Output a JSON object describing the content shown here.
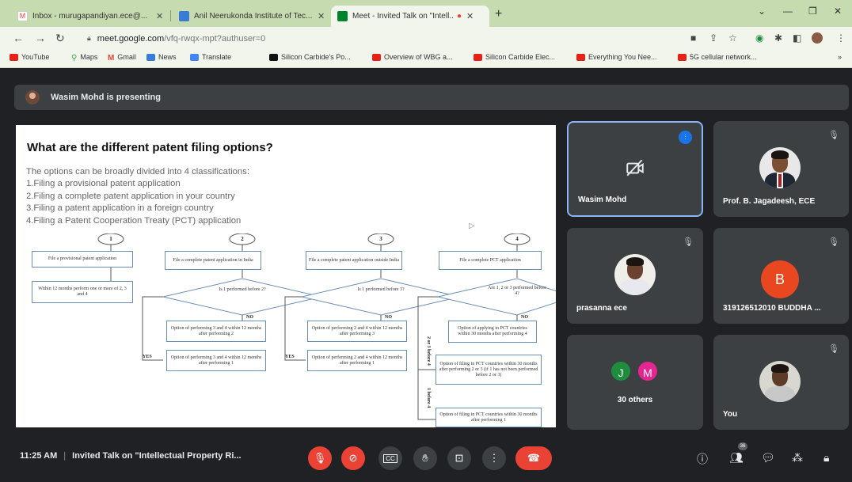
{
  "browser": {
    "tabs": [
      {
        "title": "Inbox - murugapandiyan.ece@...",
        "active": false
      },
      {
        "title": "Anil Neerukonda Institute of Tec...",
        "active": false
      },
      {
        "title": "Meet - Invited Talk on \"Intell...",
        "active": true
      }
    ],
    "new_tab_label": "+",
    "url_host": "meet.google.com",
    "url_path": "/vfq-rwqx-mpt?authuser=0",
    "bookmarks": [
      {
        "label": "YouTube",
        "icon": "youtube-icon"
      },
      {
        "label": "Maps",
        "icon": "maps-icon"
      },
      {
        "label": "Gmail",
        "icon": "gmail-icon"
      },
      {
        "label": "News",
        "icon": "news-icon"
      },
      {
        "label": "Translate",
        "icon": "translate-icon"
      },
      {
        "label": "Silicon Carbide's Po...",
        "icon": "bookmark-icon"
      },
      {
        "label": "Overview of WBG a...",
        "icon": "youtube-icon"
      },
      {
        "label": "Silicon Carbide Elec...",
        "icon": "youtube-icon"
      },
      {
        "label": "Everything You Nee...",
        "icon": "youtube-icon"
      },
      {
        "label": "5G cellular network...",
        "icon": "youtube-icon"
      }
    ]
  },
  "meet": {
    "presenting_text": "Wasim Mohd is presenting",
    "slide": {
      "title": "What are the different patent filing options?",
      "intro": "The options can be broadly divided into 4 classifications:",
      "options": [
        "1.Filing a provisional patent application",
        "2.Filing a complete patent application in your country",
        "3.Filing a patent application in a foreign country",
        "4.Filing a Patent Cooperation Treaty (PCT) application"
      ],
      "flowchart": {
        "numbers": [
          "1",
          "2",
          "3",
          "4"
        ],
        "boxes": [
          "File a provisional patent application",
          "Within 12 months perform one or more of 2, 3 and 4",
          "File a complete patent application in India",
          "Option of performing 3 and 4 within 12 months after performing 2",
          "Option of performing 3 and 4 within 12 months after performing 1",
          "File a complete patent application outside India",
          "Option of performing 2 and 4 within 12 months after performing 3",
          "Option of performing 2 and 4 within 12 months after performing 1",
          "File a complete PCT application",
          "Option of applying in PCT countries within 30 months after performing 4",
          "Option of filing in PCT countries within 30 months after performing 2 or 3 (if 1 has not been performed before 2 or 3)",
          "Option of filing in PCT countries within 30 months after performing 1"
        ],
        "diamonds": [
          "Is 1 performed before 2?",
          "Is 1 performed before 3?",
          "Are 1, 2 or 3 performed before 4?"
        ],
        "yes_label": "YES",
        "no_label": "NO",
        "side_labels": [
          "2 or 3 before 4",
          "1 before 4"
        ]
      }
    },
    "participants": [
      {
        "name": "Wasim Mohd",
        "status": "speaking",
        "video": "off"
      },
      {
        "name": "Prof. B. Jagadeesh, ECE",
        "status": "muted",
        "video": "photo"
      },
      {
        "name": "prasanna ece",
        "status": "muted",
        "video": "photo"
      },
      {
        "name": "319126512010 BUDDHA ...",
        "status": "muted",
        "avatar_letter": "B",
        "avatar_color": "#e8471f"
      },
      {
        "name": "30 others",
        "avatars": [
          {
            "letter": "J",
            "color": "#1e8e3e"
          },
          {
            "letter": "M",
            "color": "#e52592"
          }
        ]
      },
      {
        "name": "You",
        "status": "muted",
        "video": "photo"
      }
    ],
    "bottom_bar": {
      "time": "11:25 AM",
      "separator": "|",
      "meeting_title": "Invited Talk on \"Intellectual Property Ri...",
      "participant_count": "36"
    },
    "colors": {
      "end_call": "#ea4335",
      "speaking_border": "#8ab4f8",
      "tile_bg": "#3c4043",
      "background": "#202124"
    }
  }
}
